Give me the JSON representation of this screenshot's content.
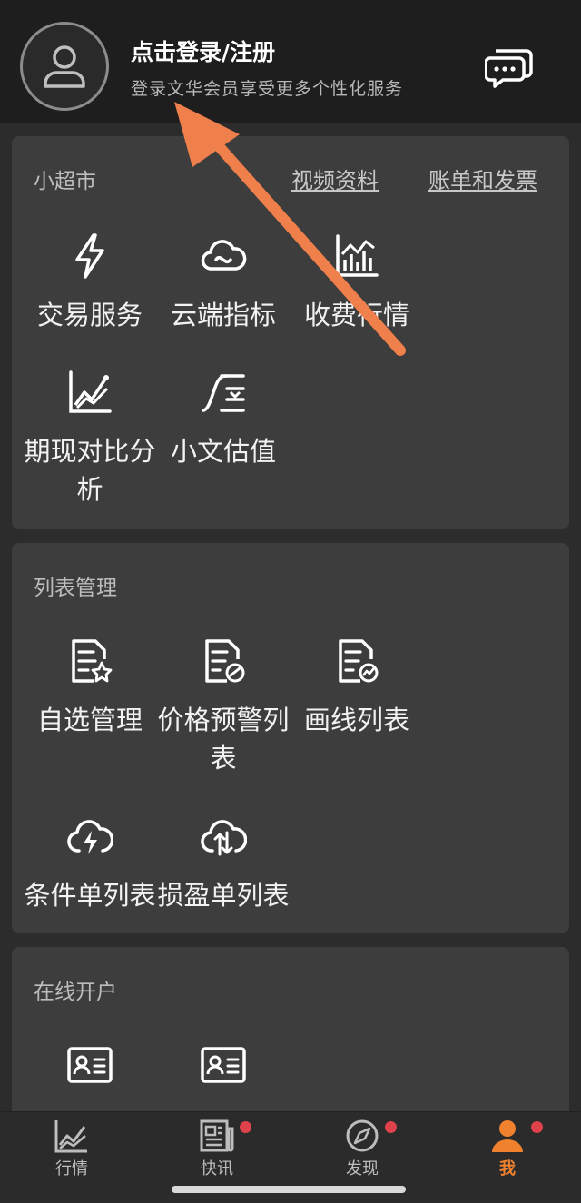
{
  "header": {
    "login_title": "点击登录/注册",
    "login_subtitle": "登录文华会员享受更多个性化服务"
  },
  "mini_market": {
    "title": "小超市",
    "link_video": "视频资料",
    "link_bills": "账单和发票",
    "items": [
      {
        "label": "交易服务",
        "icon": "lightning-icon"
      },
      {
        "label": "云端指标",
        "icon": "cloud-icon"
      },
      {
        "label": "收费行情",
        "icon": "bar-chart-icon"
      },
      {
        "label": "期现对比分析",
        "icon": "line-chart-icon"
      },
      {
        "label": "小文估值",
        "icon": "valuation-icon"
      }
    ]
  },
  "list_management": {
    "title": "列表管理",
    "items": [
      {
        "label": "自选管理",
        "icon": "document-star-icon"
      },
      {
        "label": "价格预警列表",
        "icon": "document-alert-icon"
      },
      {
        "label": "画线列表",
        "icon": "document-chart-icon"
      },
      {
        "label": "条件单列表",
        "icon": "cloud-lightning-icon"
      },
      {
        "label": "损盈单列表",
        "icon": "cloud-exchange-icon"
      }
    ]
  },
  "online_account": {
    "title": "在线开户",
    "items": [
      {
        "icon": "id-card-icon"
      },
      {
        "icon": "id-card-icon"
      }
    ]
  },
  "tabbar": {
    "tabs": [
      {
        "label": "行情",
        "icon": "market-chart-icon",
        "badge": false
      },
      {
        "label": "快讯",
        "icon": "newspaper-icon",
        "badge": true
      },
      {
        "label": "发现",
        "icon": "compass-icon",
        "badge": true
      },
      {
        "label": "我",
        "icon": "person-icon",
        "badge": true,
        "active": true
      }
    ]
  },
  "colors": {
    "accent": "#f0822e",
    "badge": "#e0424b",
    "card": "#3d3d3d",
    "header": "#1e1e1e"
  }
}
